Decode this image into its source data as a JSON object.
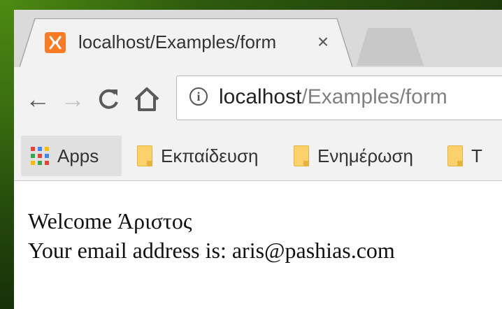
{
  "browser": {
    "tab": {
      "title": "localhost/Examples/form",
      "close_label": "×",
      "favicon": "xampp-icon"
    },
    "toolbar": {
      "back_icon": "←",
      "forward_icon": "→",
      "reload_icon": "C",
      "home_icon": "⌂",
      "url_host": "localhost",
      "url_path": "/Examples/form"
    },
    "bookmarks": [
      {
        "label": "Apps",
        "icon": "apps-grid-icon"
      },
      {
        "label": "Εκπαίδευση",
        "icon": "folder-icon"
      },
      {
        "label": "Ενημέρωση",
        "icon": "folder-icon"
      },
      {
        "label": "T",
        "icon": "folder-icon"
      }
    ]
  },
  "page": {
    "welcome": "Welcome Άριστος",
    "email": "Your email address is: aris@pashias.com"
  },
  "colors": {
    "favicon": "#fb7a24",
    "folder": "#fbd16b"
  }
}
